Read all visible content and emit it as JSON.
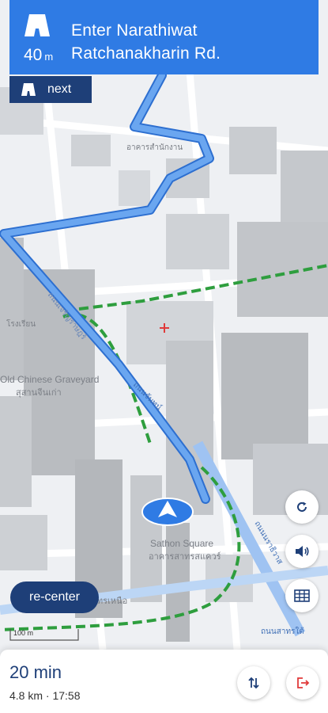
{
  "banner": {
    "distance_value": "40",
    "distance_unit": "m",
    "street_line1": "Enter Narathiwat",
    "street_line2": "Ratchanakharin Rd."
  },
  "next_label": "next",
  "map": {
    "labels": {
      "cemetery_en": "Old Chinese Graveyard",
      "cemetery_th": "สุสานจีนเก่า",
      "square_en": "Sathon Square",
      "square_th": "อาคารสาทรสแควร์",
      "road_left_th": "ถนนเจริญราษฎร์",
      "road_right_th": "ถนนนราธิวาส",
      "road_bottom_th": "สาทรเหนือ",
      "road_bottom_right_th": "ถนนสาทรใต้",
      "road_mid_th": "ถนนจันทน์",
      "building_th": "อาคารสำนักงาน",
      "area_th": "โรงเรียน",
      "scale": "100 m"
    },
    "colors": {
      "route": "#4a8fe7",
      "route_outline": "#2d6fd0",
      "rail": "#2e9e3e",
      "base": "#eef0f3"
    }
  },
  "controls": {
    "refresh_icon": "refresh-icon",
    "sound_icon": "speaker-icon",
    "grid_icon": "keyboard-grid-icon",
    "recenter_label": "re-center"
  },
  "eta": {
    "duration": "20 min",
    "details": "4.8 km · 17:58",
    "alternate_icon": "swap-routes-icon",
    "exit_icon": "exit-icon"
  },
  "accent": "#2f7be4",
  "navy": "#1e3f78",
  "exit_color": "#e03a3a"
}
